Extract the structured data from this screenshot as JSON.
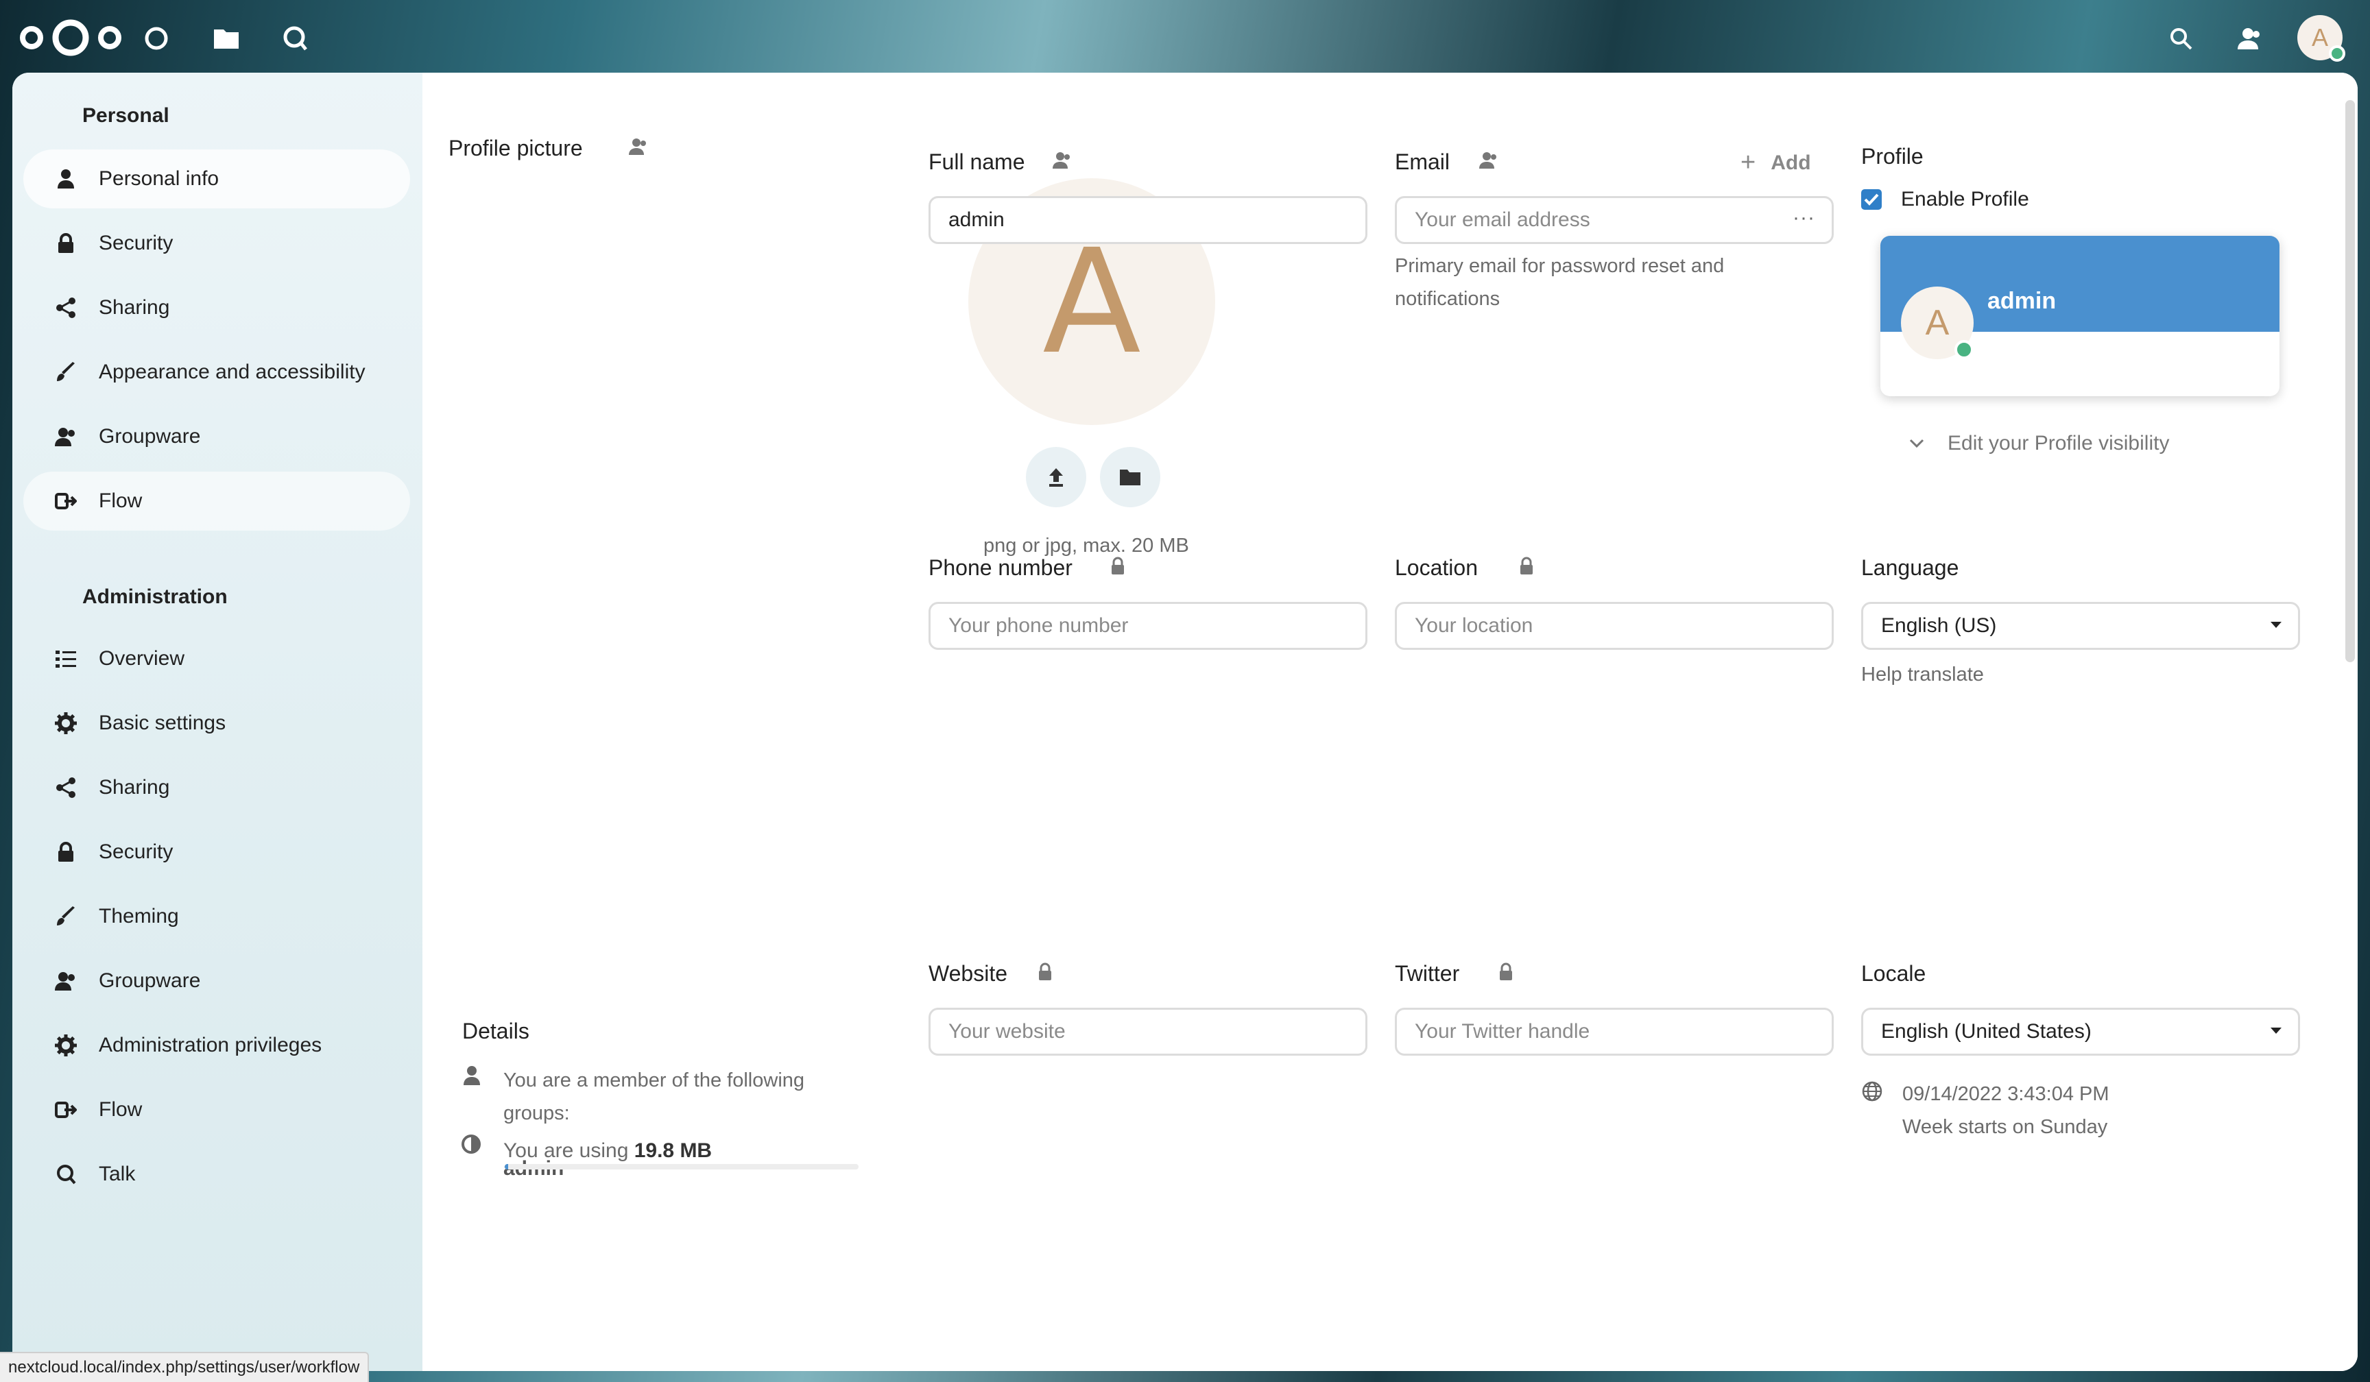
{
  "colors": {
    "accent": "#4a90cf",
    "status_online": "#49b382",
    "avatar_letter": "#c49a6c"
  },
  "header": {
    "app_icons": [
      "dashboard-icon",
      "files-icon",
      "talk-icon"
    ],
    "right_icons": [
      "search-icon",
      "contacts-icon"
    ],
    "avatar_letter": "A"
  },
  "sidebar": {
    "personal_title": "Personal",
    "personal_items": [
      {
        "label": "Personal info",
        "icon": "user-icon"
      },
      {
        "label": "Security",
        "icon": "lock-icon"
      },
      {
        "label": "Sharing",
        "icon": "share-icon"
      },
      {
        "label": "Appearance and accessibility",
        "icon": "brush-icon"
      },
      {
        "label": "Groupware",
        "icon": "group-icon"
      },
      {
        "label": "Flow",
        "icon": "flow-icon"
      }
    ],
    "admin_title": "Administration",
    "admin_items": [
      {
        "label": "Overview",
        "icon": "list-icon"
      },
      {
        "label": "Basic settings",
        "icon": "gear-icon"
      },
      {
        "label": "Sharing",
        "icon": "share-icon"
      },
      {
        "label": "Security",
        "icon": "lock-icon"
      },
      {
        "label": "Theming",
        "icon": "brush-icon"
      },
      {
        "label": "Groupware",
        "icon": "group-icon"
      },
      {
        "label": "Administration privileges",
        "icon": "gear-icon"
      },
      {
        "label": "Flow",
        "icon": "flow-icon"
      },
      {
        "label": "Talk",
        "icon": "talk-icon"
      }
    ]
  },
  "profile_picture": {
    "title": "Profile picture",
    "avatar_letter": "A",
    "hint": "png or jpg, max. 20 MB"
  },
  "full_name": {
    "label": "Full name",
    "value": "admin"
  },
  "email": {
    "label": "Email",
    "add_label": "Add",
    "placeholder": "Your email address",
    "hint": "Primary email for password reset and notifications"
  },
  "profile": {
    "title": "Profile",
    "enable_label": "Enable Profile",
    "enabled": true,
    "card_name": "admin",
    "card_avatar_letter": "A",
    "visibility_label": "Edit your Profile visibility"
  },
  "phone": {
    "label": "Phone number",
    "placeholder": "Your phone number"
  },
  "location": {
    "label": "Location",
    "placeholder": "Your location"
  },
  "language": {
    "label": "Language",
    "value": "English (US)",
    "help": "Help translate"
  },
  "details": {
    "title": "Details",
    "groups_text": "You are a member of the following groups:",
    "group_name": "admin",
    "usage_prefix": "You are using",
    "usage_value": "19.8 MB",
    "usage_fraction": 0.01
  },
  "website": {
    "label": "Website",
    "placeholder": "Your website"
  },
  "twitter": {
    "label": "Twitter",
    "placeholder": "Your Twitter handle"
  },
  "locale": {
    "label": "Locale",
    "value": "English (United States)",
    "datetime": "09/14/2022 3:43:04 PM",
    "week_start": "Week starts on Sunday"
  },
  "status_bar": {
    "url": "nextcloud.local/index.php/settings/user/workflow"
  }
}
